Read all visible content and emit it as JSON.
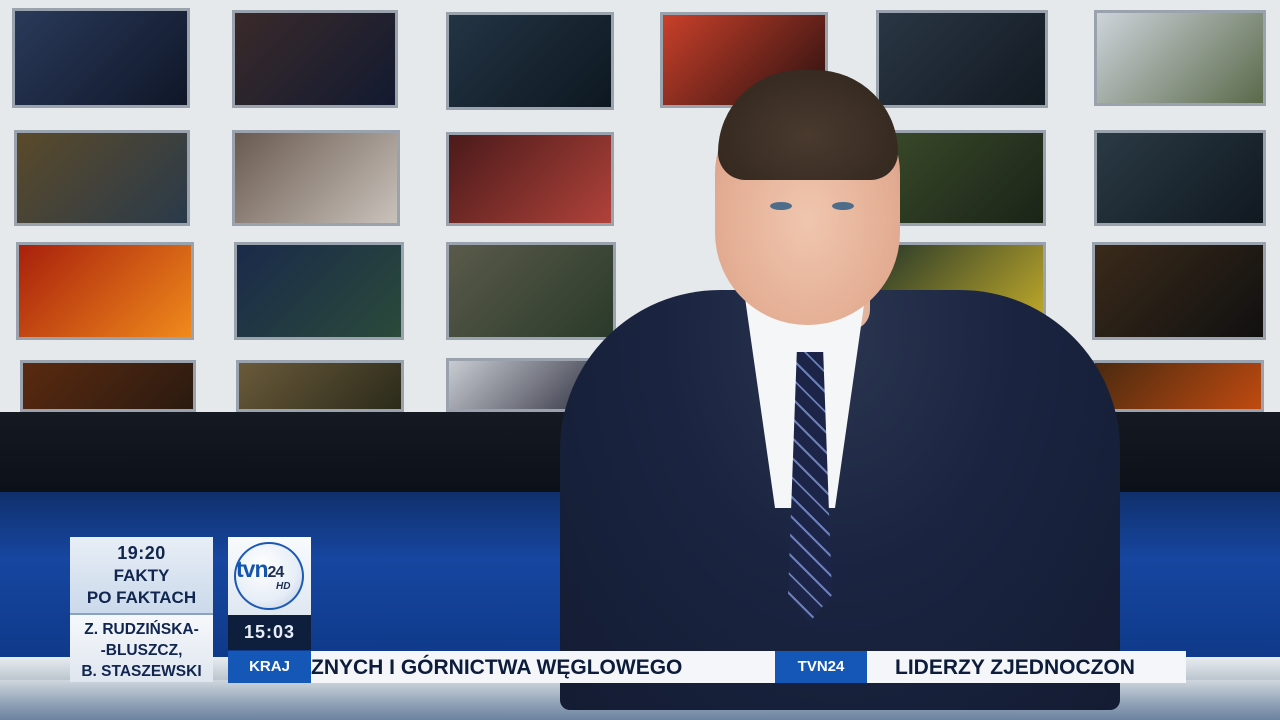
{
  "info_box": {
    "time": "19:20",
    "show_line1": "FAKTY",
    "show_line2": "PO FAKTACH",
    "names_line1": "Z. RUDZIŃSKA-",
    "names_line2": "-BLUSZCZ,",
    "names_line3": "B. STASZEWSKI"
  },
  "logo": {
    "brand": "tvn",
    "number": "24",
    "hd": "HD"
  },
  "clock": "15:03",
  "ticker": {
    "category": "KRAJ",
    "headline1": "ZNYCH I GÓRNICTWA WĘGLOWEGO",
    "channel_tag": "TVN24",
    "headline2": "LIDERZY ZJEDNOCZON"
  },
  "colors": {
    "accent_blue": "#1457b6",
    "navy": "#0d1f3d",
    "ticker_bg": "#f4f6f9"
  }
}
